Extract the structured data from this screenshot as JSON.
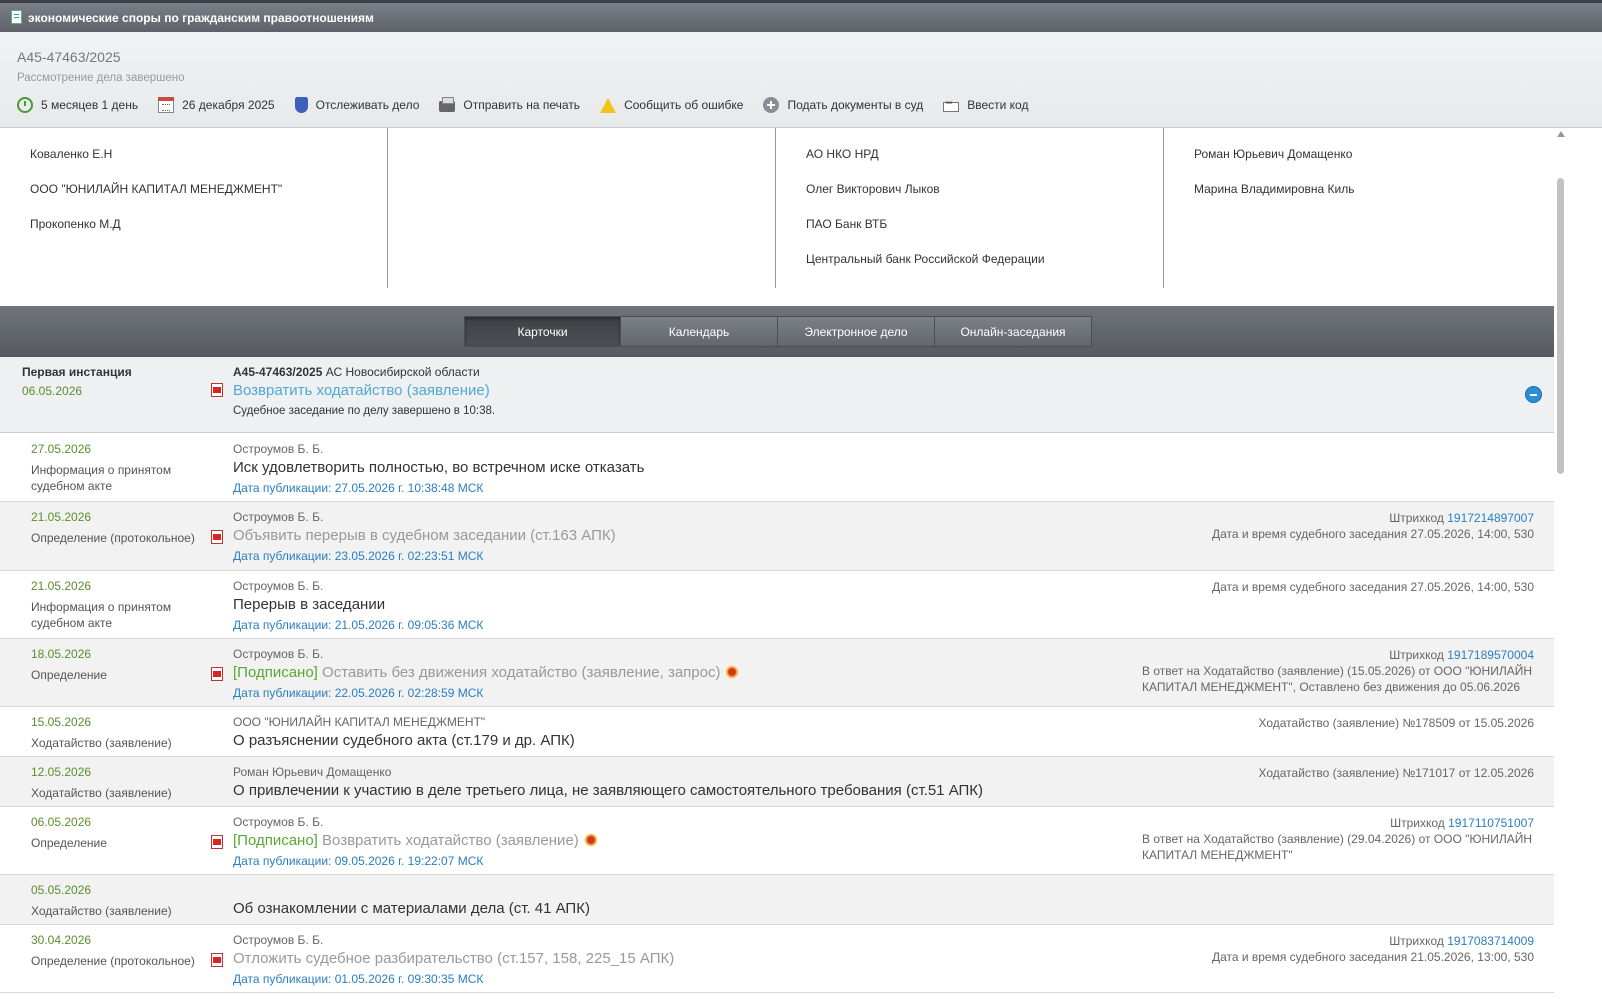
{
  "window": {
    "title": "экономические споры по гражданским правоотношениям"
  },
  "case": {
    "number": "А45-47463/2025",
    "status": "Рассмотрение дела завершено"
  },
  "toolbar": {
    "duration": "5 месяцев 1 день",
    "date": "26 декабря 2025",
    "track": "Отслеживать дело",
    "print": "Отправить на печать",
    "report_error": "Сообщить об ошибке",
    "submit_docs": "Подать документы в суд",
    "enter_code": "Ввести код"
  },
  "participants": {
    "col1": [
      "Коваленко Е.Н",
      "ООО \"ЮНИЛАЙН КАПИТАЛ МЕНЕДЖМЕНТ\"",
      "Прокопенко М.Д"
    ],
    "col3": [
      "АО НКО НРД",
      "Олег Викторович Лыков",
      "ПАО Банк ВТБ",
      "Центральный банк Российской Федерации"
    ],
    "col4": [
      "Роман Юрьевич Домащенко",
      "Марина Владимировна Киль"
    ]
  },
  "tabs": [
    "Карточки",
    "Календарь",
    "Электронное дело",
    "Онлайн-заседания"
  ],
  "instance": {
    "title": "Первая инстанция",
    "date": "06.05.2026",
    "case_number": "А45-47463/2025",
    "court": " АС Новосибирской области",
    "link": "Возвратить ходатайство (заявление)",
    "note": "Судебное заседание по делу завершено в 10:38."
  },
  "events": [
    {
      "date": "27.05.2026",
      "type": "Информация о принятом судебном акте",
      "author": "Остроумов Б. Б.",
      "title": "Иск удовлетворить полностью, во встречном иске отказать",
      "pub": "Дата публикации: 27.05.2026 г. 10:38:48 МСК"
    },
    {
      "date": "21.05.2026",
      "type": "Определение (протокольное)",
      "author": "Остроумов Б. Б.",
      "title": "Объявить перерыв в судебном заседании (ст.163 АПК)",
      "pub": "Дата публикации: 23.05.2026 г. 02:23:51 МСК",
      "barcode_label": "Штрихкод ",
      "barcode": "1917214897007",
      "hearing": "Дата и время судебного заседания 27.05.2026, 14:00, 530"
    },
    {
      "date": "21.05.2026",
      "type": "Информация о принятом судебном акте",
      "author": "Остроумов Б. Б.",
      "title": "Перерыв в заседании",
      "pub": "Дата публикации: 21.05.2026 г. 09:05:36 МСК",
      "hearing": "Дата и время судебного заседания 27.05.2026, 14:00, 530"
    },
    {
      "date": "18.05.2026",
      "type": "Определение",
      "author": "Остроумов Б. Б.",
      "signed": "[Подписано]",
      "title": " Оставить без движения ходатайство (заявление, запрос)",
      "pub": "Дата публикации: 22.05.2026 г. 02:28:59 МСК",
      "barcode_label": "Штрихкод ",
      "barcode": "1917189570004",
      "reply": "В ответ на Ходатайство (заявление) (15.05.2026) от ООО \"ЮНИЛАЙН КАПИТАЛ МЕНЕДЖМЕНТ\", Оставлено без движения до 05.06.2026"
    },
    {
      "date": "15.05.2026",
      "type": "Ходатайство (заявление)",
      "author": "ООО \"ЮНИЛАЙН КАПИТАЛ МЕНЕДЖМЕНТ\"",
      "title": "О разъяснении судебного акта (ст.179 и др. АПК)",
      "petition": "Ходатайство (заявление) №178509 от 15.05.2026"
    },
    {
      "date": "12.05.2026",
      "type": "Ходатайство (заявление)",
      "author": "Роман Юрьевич Домащенко",
      "title": "О привлечении к участию в деле третьего лица, не заявляющего самостоятельного требования (ст.51 АПК)",
      "petition": "Ходатайство (заявление) №171017 от 12.05.2026"
    },
    {
      "date": "06.05.2026",
      "type": "Определение",
      "author": "Остроумов Б. Б.",
      "signed": "[Подписано]",
      "title": " Возвратить ходатайство (заявление)",
      "pub": "Дата публикации: 09.05.2026 г. 19:22:07 МСК",
      "barcode_label": "Штрихкод ",
      "barcode": "1917110751007",
      "reply": "В ответ на Ходатайство (заявление) (29.04.2026) от ООО \"ЮНИЛАЙН КАПИТАЛ МЕНЕДЖМЕНТ\""
    },
    {
      "date": "05.05.2026",
      "type": "Ходатайство (заявление)",
      "title": "Об ознакомлении с материалами дела (ст. 41 АПК)"
    },
    {
      "date": "30.04.2026",
      "type": "Определение (протокольное)",
      "author": "Остроумов Б. Б.",
      "title": "Отложить судебное разбирательство (ст.157, 158, 225_15 АПК)",
      "pub": "Дата публикации: 01.05.2026 г. 09:30:35 МСК",
      "barcode_label": "Штрихкод ",
      "barcode": "1917083714009",
      "hearing": "Дата и время судебного заседания 21.05.2026, 13:00, 530"
    }
  ]
}
